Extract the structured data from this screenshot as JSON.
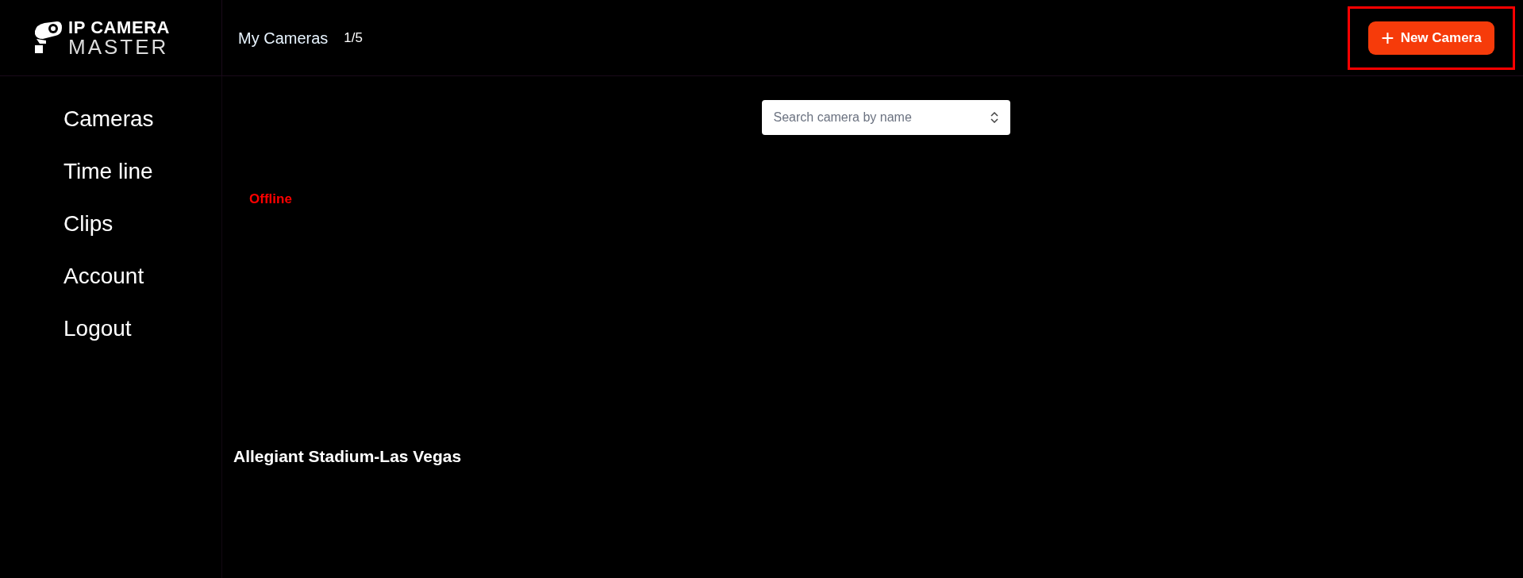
{
  "logo": {
    "line_1": "IP CAMERA",
    "line_2": "MASTER"
  },
  "header": {
    "title": "My Cameras",
    "count": "1/5",
    "button": {
      "icon": "+",
      "label": "New Camera",
      "highlighted": true
    }
  },
  "sidebar": {
    "items": [
      {
        "label": "Cameras"
      },
      {
        "label": "Time line"
      },
      {
        "label": "Clips"
      },
      {
        "label": "Account"
      },
      {
        "label": "Logout"
      }
    ]
  },
  "search": {
    "placeholder": "Search camera by name"
  },
  "cameras": [
    {
      "status": "Offline",
      "name": "Allegiant Stadium-Las Vegas"
    }
  ]
}
